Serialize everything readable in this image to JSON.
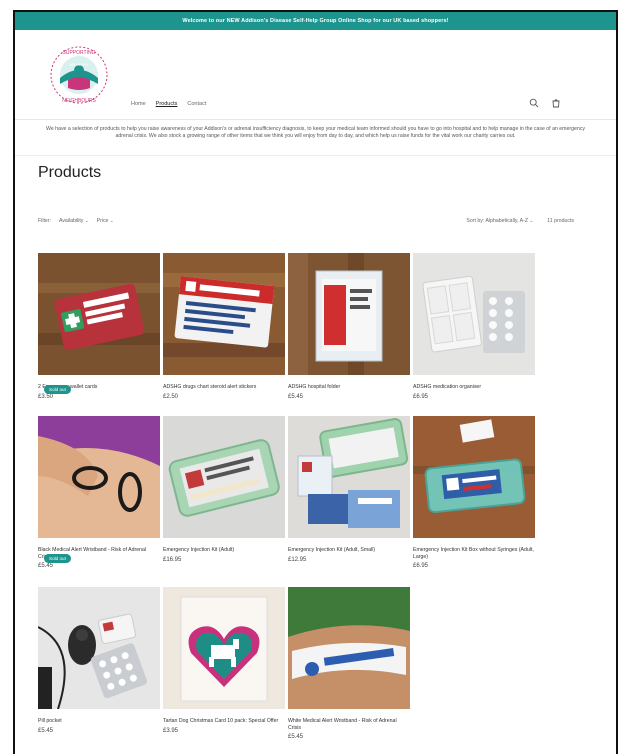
{
  "announcement": "Welcome to our NEW Addison's Disease Self-Help Group Online Shop for our UK based shoppers!",
  "logo": {
    "text_top": "SUPPORTING",
    "text_bottom": "NEIGHBOURS",
    "text_center": "ADDISON'S"
  },
  "nav": {
    "home": "Home",
    "products": "Products",
    "contact": "Contact"
  },
  "intro": "We have a selection of products to help you raise awareness of your Addison's or adrenal insufficiency diagnosis, to keep your medical team informed should you have to go into hospital and to help manage in the case of an emergency adrenal crisis. We also stock a growing range of other items that we think you will enjoy from day to day, and which help us raise funds for the vital work our charity carries out.",
  "page_title": "Products",
  "filters": {
    "label": "Filter:",
    "availability": "Availability",
    "price": "Price",
    "sort_label": "Sort by:",
    "sort_value": "Alphabetically, A-Z",
    "count": "11 products"
  },
  "colors": {
    "accent": "#1d948e"
  },
  "products": [
    {
      "name": "2 Emergency wallet cards",
      "price": "£3.50",
      "badge": "Sold out"
    },
    {
      "name": "ADSHG drugs chart steroid alert stickers",
      "price": "£2.50",
      "badge": ""
    },
    {
      "name": "ADSHG hospital folder",
      "price": "£5.45",
      "badge": ""
    },
    {
      "name": "ADSHG medication organiser",
      "price": "£6.95",
      "badge": ""
    },
    {
      "name": "Black Medical Alert Wristband - Risk of Adrenal Crisis",
      "price": "£5.45",
      "badge": "Sold out"
    },
    {
      "name": "Emergency Injection Kit (Adult)",
      "price": "£16.95",
      "badge": ""
    },
    {
      "name": "Emergency Injection Kit (Adult, Small)",
      "price": "£12.95",
      "badge": ""
    },
    {
      "name": "Emergency Injection Kit Box without Syringes (Adult, Large)",
      "price": "£6.95",
      "badge": ""
    },
    {
      "name": "Pill pocket",
      "price": "£5.45",
      "badge": ""
    },
    {
      "name": "Tartan Dog Christmas Card 10 pack: Special Offer",
      "price": "£3.95",
      "badge": ""
    },
    {
      "name": "White Medical Alert Wristband - Risk of Adrenal Crisis",
      "price": "£5.45",
      "badge": ""
    }
  ]
}
